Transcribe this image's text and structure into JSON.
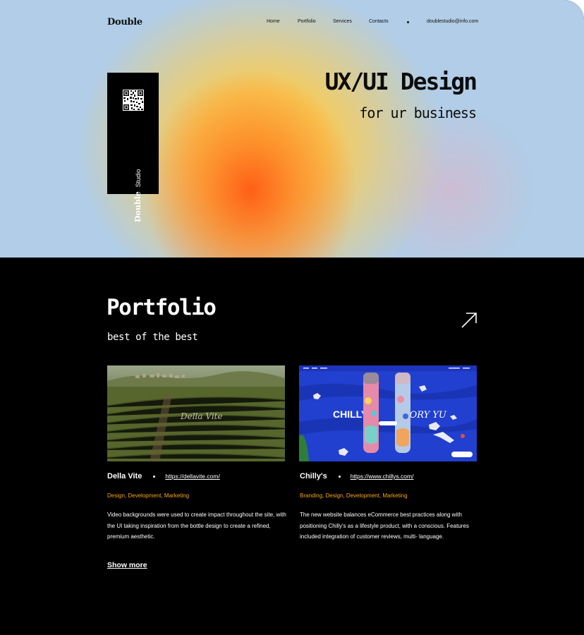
{
  "header": {
    "logo": "Double",
    "nav": [
      "Home",
      "Portfolio",
      "Services",
      "Contacts"
    ],
    "email": "doublestudio@info.com"
  },
  "card": {
    "logo": "Double",
    "label": "Studio"
  },
  "hero": {
    "title": "UX/UI Design",
    "subtitle": "for ur business"
  },
  "portfolio": {
    "title": "Portfolio",
    "subtitle": "best of the best",
    "projects": [
      {
        "name": "Della Vite",
        "url": "https://dellavite.com/",
        "tags": "Design, Development, Marketing",
        "description": "Video backgrounds were used to create impact throughout the site, with the UI taking inspiration from the bottle design to create a refined, premium aesthetic.",
        "thumb_text": "Della Vite"
      },
      {
        "name": "Chilly's",
        "url": "https://www.chillys.com/",
        "tags": "Branding, Design, Development, Marketing",
        "description": "The new website balances eCommerce best practices along with positioning Chilly's as a lifestyle product, with a conscious. Features included integration of customer reviews, multi- language.",
        "thumb_text": "CHILLY'S",
        "thumb_collab": "YORY YU"
      }
    ],
    "show_more": "Show more"
  },
  "colors": {
    "hero_bg": "#b1cde7",
    "accent_tags": "#f5a51c",
    "dark_bg": "#000000"
  },
  "icons": [
    "qr-code-icon",
    "arrow-up-right-icon"
  ]
}
